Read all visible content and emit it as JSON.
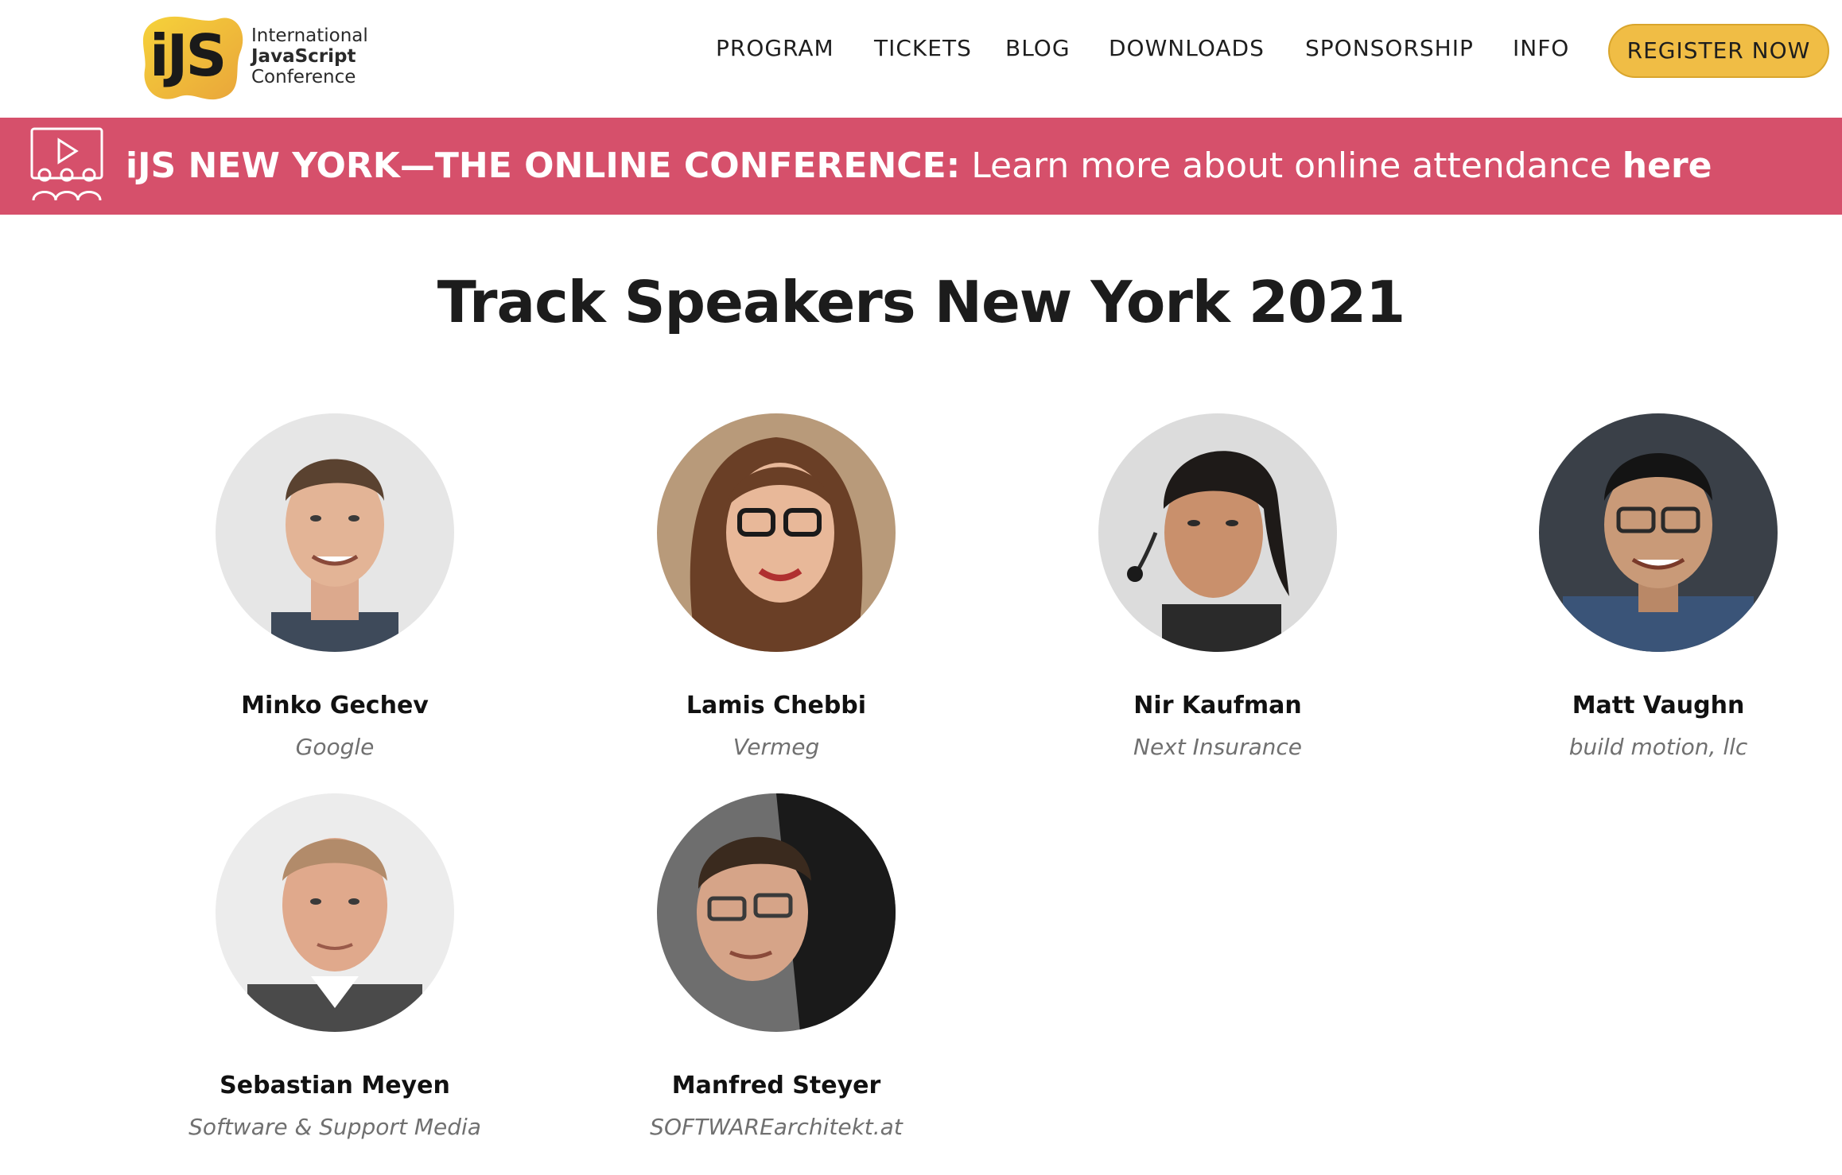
{
  "logo": {
    "mark": "iJS",
    "line1": "International",
    "line2": "JavaScript",
    "line3": "Conference"
  },
  "nav": {
    "items": [
      "PROGRAM",
      "TICKETS",
      "BLOG",
      "DOWNLOADS",
      "SPONSORSHIP",
      "INFO"
    ],
    "register_label": "REGISTER NOW"
  },
  "banner": {
    "headline": "iJS NEW YORK—THE ONLINE CONFERENCE:",
    "text": "Learn more about online attendance",
    "link": "here"
  },
  "page_title": "Track Speakers New York 2021",
  "speakers": [
    {
      "name": "Minko Gechev",
      "company": "Google"
    },
    {
      "name": "Lamis Chebbi",
      "company": "Vermeg"
    },
    {
      "name": "Nir Kaufman",
      "company": "Next Insurance"
    },
    {
      "name": "Matt Vaughn",
      "company": "build motion, llc"
    },
    {
      "name": "Sebastian Meyen",
      "company": "Software & Support Media"
    },
    {
      "name": "Manfred Steyer",
      "company": "SOFTWAREarchitekt.at"
    }
  ],
  "colors": {
    "accent": "#d6506b",
    "button": "#f0bd45",
    "text": "#1c1c1c",
    "muted": "#707070"
  }
}
